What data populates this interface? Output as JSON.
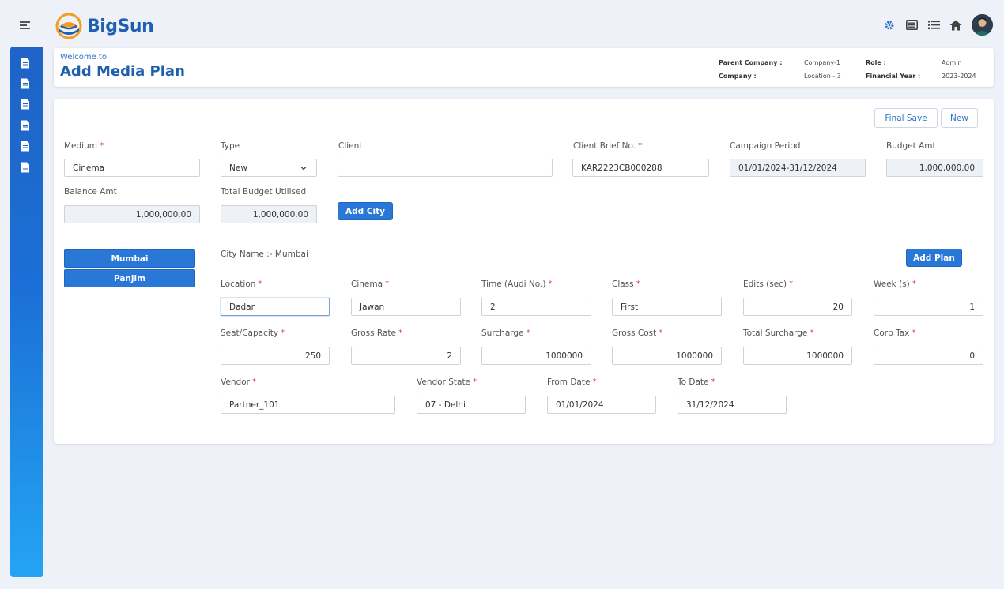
{
  "app": {
    "name": "BigSun"
  },
  "header": {
    "welcome": "Welcome to",
    "title": "Add Media Plan",
    "meta": [
      {
        "label": "Parent Company :",
        "value": "Company-1"
      },
      {
        "label": "Company :",
        "value": "Location - 3"
      },
      {
        "label": "Role :",
        "value": "Admin"
      },
      {
        "label": "Financial Year :",
        "value": "2023-2024"
      }
    ]
  },
  "top_icons": [
    "gear-icon",
    "list-box-icon",
    "list-icon",
    "home-icon",
    "user-avatar"
  ],
  "actions": {
    "final_save": "Final Save",
    "new": "New",
    "add_city": "Add City",
    "add_plan": "Add Plan"
  },
  "form": {
    "medium": {
      "label": "Medium",
      "value": "Cinema"
    },
    "type": {
      "label": "Type",
      "value": "New"
    },
    "client": {
      "label": "Client",
      "value": ""
    },
    "client_brief": {
      "label": "Client Brief No.",
      "value": "KAR2223CB000288"
    },
    "campaign_period": {
      "label": "Campaign Period",
      "value": "01/01/2024-31/12/2024"
    },
    "budget_amt": {
      "label": "Budget Amt",
      "value": "1,000,000.00"
    },
    "balance_amt": {
      "label": "Balance Amt",
      "value": "1,000,000.00"
    },
    "total_budget": {
      "label": "Total Budget Utilised",
      "value": "1,000,000.00"
    }
  },
  "cities": [
    "Mumbai",
    "Panjim"
  ],
  "city_name_label": "City Name :- Mumbai",
  "plan": {
    "location": {
      "label": "Location",
      "value": "Dadar"
    },
    "cinema": {
      "label": "Cinema",
      "value": "Jawan"
    },
    "time": {
      "label": "Time (Audi No.)",
      "value": "2"
    },
    "class": {
      "label": "Class",
      "value": "First"
    },
    "edits": {
      "label": "Edits (sec)",
      "value": "20"
    },
    "week": {
      "label": "Week (s)",
      "value": "1"
    },
    "seat": {
      "label": "Seat/Capacity",
      "value": "250"
    },
    "gross_rate": {
      "label": "Gross Rate",
      "value": "2"
    },
    "surcharge": {
      "label": "Surcharge",
      "value": "1000000"
    },
    "gross_cost": {
      "label": "Gross Cost",
      "value": "1000000"
    },
    "total_surcharge": {
      "label": "Total Surcharge",
      "value": "1000000"
    },
    "corp_tax": {
      "label": "Corp Tax",
      "value": "0"
    },
    "vendor": {
      "label": "Vendor",
      "value": "Partner_101"
    },
    "vendor_state": {
      "label": "Vendor State",
      "value": "07 - Delhi"
    },
    "from_date": {
      "label": "From Date",
      "value": "01/01/2024"
    },
    "to_date": {
      "label": "To Date",
      "value": "31/12/2024"
    }
  },
  "colors": {
    "primary": "#2977d6",
    "title": "#1f5fae",
    "required": "#e23c4b"
  }
}
